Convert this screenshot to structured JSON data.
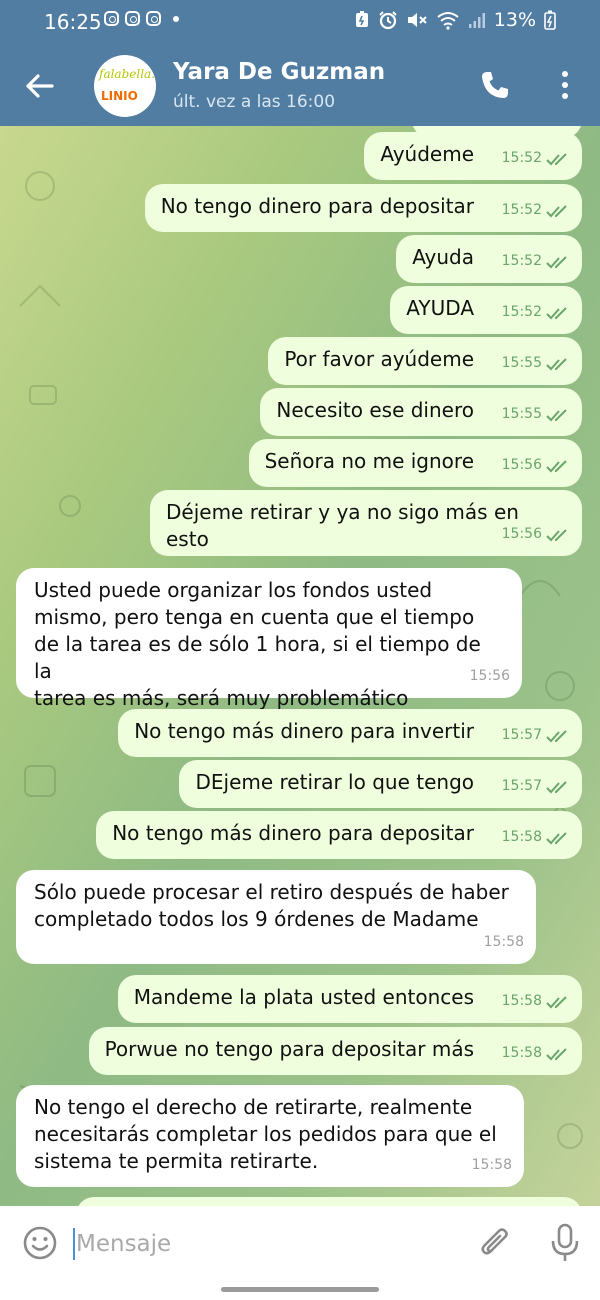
{
  "status_bar": {
    "time": "16:25",
    "battery": "13%",
    "icons": [
      "instagram-icon",
      "instagram-icon",
      "instagram-icon",
      "dot-icon",
      "battery-saver-icon",
      "alarm-icon",
      "mute-icon",
      "wifi-icon",
      "signal-icon",
      "battery-charging-icon"
    ]
  },
  "header": {
    "contact_name": "Yara De Guzman",
    "last_seen": "últ. vez a las 16:00",
    "avatar_text_1": "falabella.",
    "avatar_text_2": "LINIO"
  },
  "messages": [
    {
      "dir": "out",
      "text": "Ayúdeme",
      "time": "15:52"
    },
    {
      "dir": "out",
      "text": "No tengo dinero para depositar",
      "time": "15:52"
    },
    {
      "dir": "out",
      "text": "Ayuda",
      "time": "15:52"
    },
    {
      "dir": "out",
      "text": "AYUDA",
      "time": "15:52"
    },
    {
      "dir": "out",
      "text": "Por favor ayúdeme",
      "time": "15:55"
    },
    {
      "dir": "out",
      "text": "Necesito ese dinero",
      "time": "15:55"
    },
    {
      "dir": "out",
      "text": "Señora no me ignore",
      "time": "15:56"
    },
    {
      "dir": "out",
      "text": "Déjeme retirar y ya no sigo más en esto",
      "time": "15:56"
    },
    {
      "dir": "in",
      "text": "Usted puede organizar los fondos usted\nmismo, pero tenga en cuenta que el tiempo\nde la tarea es de sólo 1 hora, si el tiempo de la\ntarea es más, será muy problemático",
      "time": "15:56"
    },
    {
      "dir": "out",
      "text": "No tengo más dinero para invertir",
      "time": "15:57"
    },
    {
      "dir": "out",
      "text": "DEjeme retirar lo que tengo",
      "time": "15:57"
    },
    {
      "dir": "out",
      "text": "No tengo más dinero para depositar",
      "time": "15:58"
    },
    {
      "dir": "in",
      "text": "Sólo puede procesar el retiro después de haber\ncompletado todos los 9 órdenes de Madame",
      "time": "15:58"
    },
    {
      "dir": "out",
      "text": "Mandeme la plata usted entonces",
      "time": "15:58"
    },
    {
      "dir": "out",
      "text": "Porwue no tengo para depositar más",
      "time": "15:58"
    },
    {
      "dir": "in",
      "text": "No tengo el derecho de retirarte, realmente\nnecesitarás completar los pedidos para que el\nsistema te permita retirarte.",
      "time": "15:58"
    }
  ],
  "input": {
    "placeholder": "Mensaje",
    "value": ""
  },
  "colors": {
    "header_bg": "#517da2",
    "outgoing_bubble": "#effedd",
    "incoming_bubble": "#ffffff",
    "read_ticks": "#6aa56b"
  }
}
